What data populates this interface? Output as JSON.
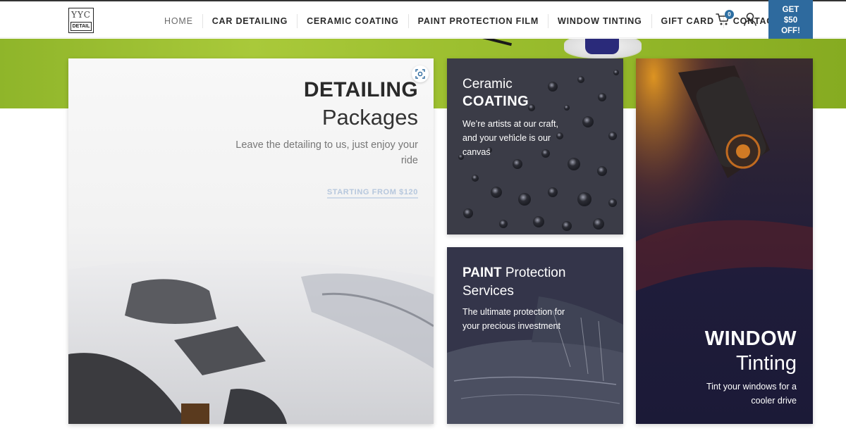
{
  "logo": {
    "line1": "YYC",
    "line2": "DETAIL"
  },
  "nav": {
    "items": [
      {
        "label": "HOME"
      },
      {
        "label": "CAR DETAILING"
      },
      {
        "label": "CERAMIC COATING"
      },
      {
        "label": "PAINT PROTECTION FILM"
      },
      {
        "label": "WINDOW TINTING"
      },
      {
        "label": "GIFT CARD"
      },
      {
        "label": "CONTACT US"
      }
    ],
    "cart_count": "0",
    "cart_icon": "cart-icon",
    "user_icon": "user-icon"
  },
  "promo": {
    "line1": "GET",
    "line2": "$50",
    "line3": "OFF!"
  },
  "cards": {
    "detailing": {
      "title_bold": "DETAILING",
      "title_light": "Packages",
      "description": "Leave the detailing to us, just enjoy your ride",
      "cta": "STARTING FROM $120",
      "lens_icon": "visual-search-icon"
    },
    "ceramic": {
      "title_light": "Ceramic",
      "title_bold": "COATING",
      "description": "We’re artists at our craft, and your vehicle is our canvas"
    },
    "paint": {
      "title_bold": "PAINT",
      "title_light": "Protection",
      "title_line2": "Services",
      "description": "The ultimate protection for your precious investment"
    },
    "window": {
      "title_bold": "WINDOW",
      "title_light": "Tinting",
      "description": "Tint your windows for a cooler drive"
    }
  },
  "colors": {
    "accent_blue": "#2e6a9e",
    "hero_green": "#9cbf2f",
    "card_dark": "#1b1a37"
  }
}
